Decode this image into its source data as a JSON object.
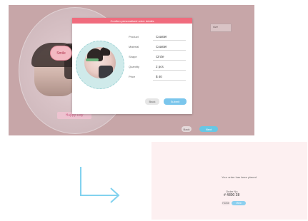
{
  "background_screen": {
    "bubble_text": "Smile",
    "caption_text": "Happy Day",
    "field_label": "size",
    "back_label": "Back",
    "next_label": "Next"
  },
  "dialog": {
    "title": "Confirm personalized order details",
    "fields": [
      {
        "label": "Product",
        "value": "Coaster"
      },
      {
        "label": "Material",
        "value": "Coaster"
      },
      {
        "label": "Shape",
        "value": "Circle"
      },
      {
        "label": "Quantity",
        "value": "2 pcs"
      },
      {
        "label": "Price",
        "value": "$ 40"
      }
    ],
    "cancel_label": "Back",
    "confirm_label": "Submit"
  },
  "result_screen": {
    "message": "Your order has been placed",
    "order_label": "Order No.",
    "order_value": "# 4800 38",
    "back_label": "Home",
    "next_label": "View"
  },
  "colors": {
    "dialog_header": "#f06b7d",
    "confirm_button": "#7bc6ec",
    "arrow": "#82d2ef"
  }
}
